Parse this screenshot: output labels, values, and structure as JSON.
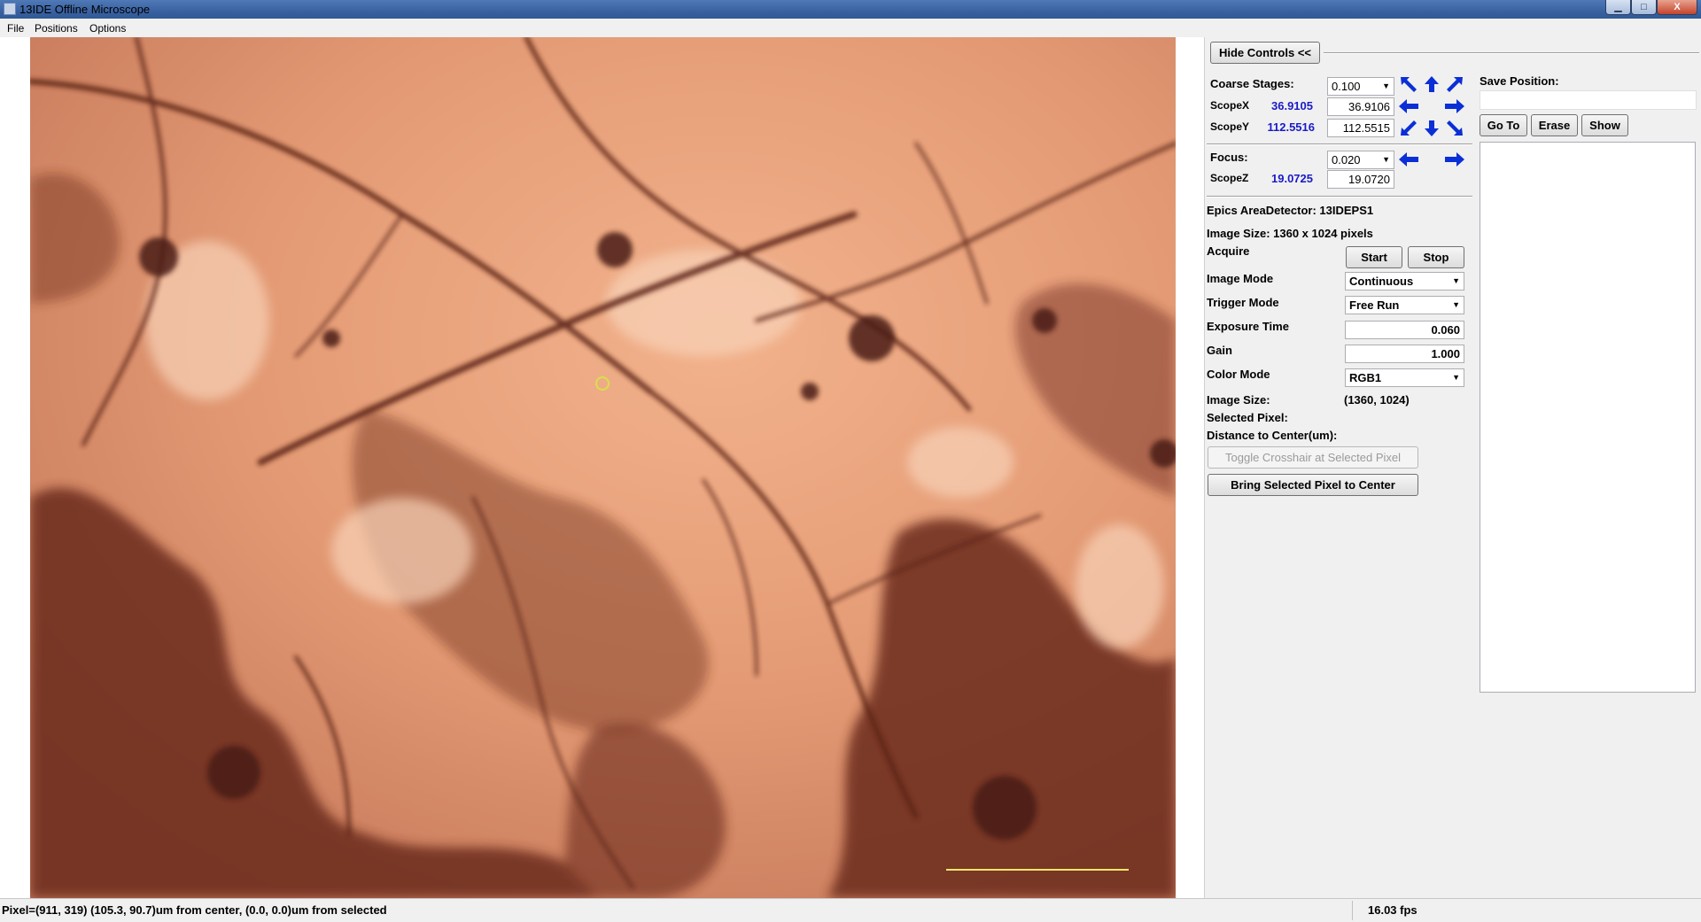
{
  "window": {
    "title": "13IDE Offline Microscope",
    "minimize_label": "▁",
    "maximize_label": "□",
    "close_label": "X"
  },
  "menu": [
    "File",
    "Positions",
    "Options"
  ],
  "controls": {
    "hide_button": "Hide Controls <<",
    "coarse_label": "Coarse Stages:",
    "coarse_step": "0.100",
    "scope_x_label": "ScopeX",
    "scope_x_readback": "36.9105",
    "scope_x_value": "36.9106",
    "scope_y_label": "ScopeY",
    "scope_y_readback": "112.5516",
    "scope_y_value": "112.5515",
    "focus_label": "Focus:",
    "focus_step": "0.020",
    "scope_z_label": "ScopeZ",
    "scope_z_readback": "19.0725",
    "scope_z_value": "19.0720"
  },
  "detector": {
    "title": "Epics AreaDetector: 13IDEPS1",
    "image_size_header": "Image Size: 1360 x 1024 pixels",
    "acquire_label": "Acquire",
    "start_button": "Start",
    "stop_button": "Stop",
    "image_mode_label": "Image Mode",
    "image_mode_value": "Continuous",
    "trigger_mode_label": "Trigger Mode",
    "trigger_mode_value": "Free Run",
    "exposure_label": "Exposure Time",
    "exposure_value": "0.060",
    "gain_label": "Gain",
    "gain_value": "1.000",
    "color_mode_label": "Color Mode",
    "color_mode_value": "RGB1",
    "image_size_label": "Image Size:",
    "image_size_value": "(1360, 1024)",
    "selected_pixel_label": "Selected Pixel:",
    "distance_label": "Distance to Center(um):",
    "toggle_crosshair_button": "Toggle Crosshair at Selected Pixel",
    "bring_center_button": "Bring Selected Pixel to Center"
  },
  "positions": {
    "save_label": "Save Position:",
    "save_value": "",
    "goto_button": "Go To",
    "erase_button": "Erase",
    "show_button": "Show"
  },
  "status": {
    "pixel_info": "Pixel=(911, 319) (105.3, 90.7)um from center, (0.0, 0.0)um from selected",
    "fps": "16.03 fps"
  },
  "colors": {
    "readback": "#1a1ac8",
    "arrow": "#0a2fd6",
    "crosshair": "#d8e04a",
    "scale_bar": "#f3e66a"
  },
  "icons": [
    "app-icon",
    "arrow-up-left-icon",
    "arrow-up-icon",
    "arrow-up-right-icon",
    "arrow-left-icon",
    "arrow-right-icon",
    "arrow-down-left-icon",
    "arrow-down-icon",
    "arrow-down-right-icon"
  ]
}
